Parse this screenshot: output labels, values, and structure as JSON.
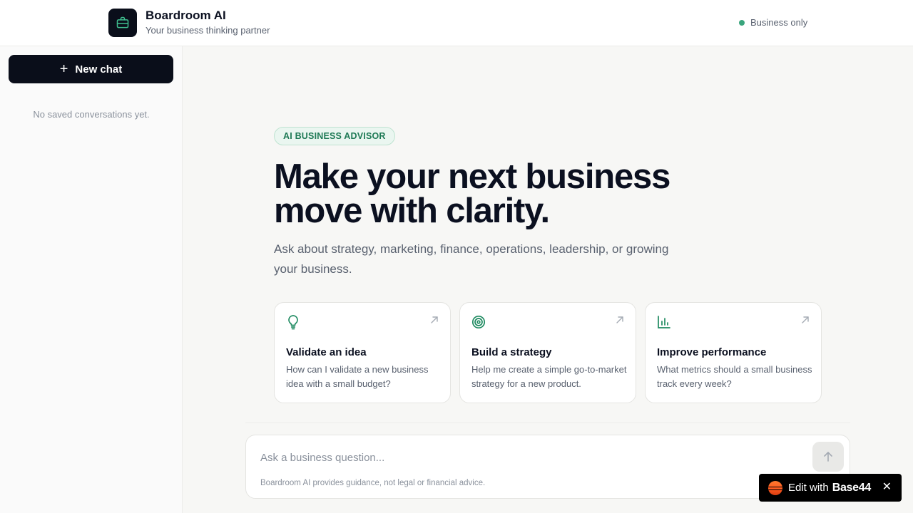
{
  "header": {
    "app_name": "Boardroom AI",
    "tagline": "Your business thinking partner",
    "logo_icon": "briefcase-icon",
    "status_label": "Business only",
    "status_color": "#3aa57d"
  },
  "sidebar": {
    "new_chat_label": "New chat",
    "new_chat_icon": "plus-icon",
    "empty_text": "No saved conversations yet."
  },
  "hero": {
    "badge": "AI BUSINESS ADVISOR",
    "headline": "Make your next business move with clarity.",
    "subtext": "Ask about strategy, marketing, finance, operations, leadership, or growing your business."
  },
  "suggestions": [
    {
      "icon": "lightbulb-icon",
      "title": "Validate an idea",
      "description": "How can I validate a new business idea with a small budget?"
    },
    {
      "icon": "target-icon",
      "title": "Build a strategy",
      "description": "Help me create a simple go-to-market strategy for a new product."
    },
    {
      "icon": "bar-chart-icon",
      "title": "Improve performance",
      "description": "What metrics should a small business track every week?"
    }
  ],
  "composer": {
    "placeholder": "Ask a business question...",
    "disclaimer": "Boardroom AI provides guidance, not legal or financial advice.",
    "send_icon": "arrow-up-icon"
  },
  "edit_badge": {
    "prefix": "Edit with",
    "brand": "Base44",
    "close_icon": "close-icon"
  },
  "colors": {
    "accent": "#1e7a55",
    "primary_dark": "#0a0e1a",
    "background": "#f7f7f5"
  }
}
